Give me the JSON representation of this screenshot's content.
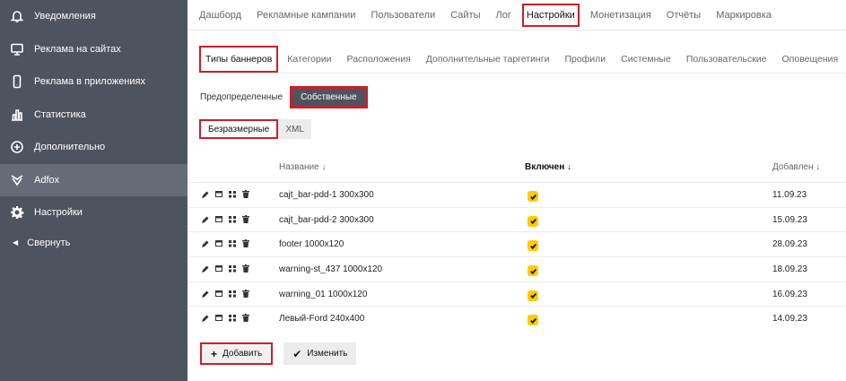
{
  "sidebar": {
    "items": [
      {
        "label": "Уведомления",
        "icon": "bell-icon",
        "active": false
      },
      {
        "label": "Реклама на сайтах",
        "icon": "monitor-icon",
        "active": false
      },
      {
        "label": "Реклама в приложениях",
        "icon": "phone-icon",
        "active": false
      },
      {
        "label": "Статистика",
        "icon": "bar-chart-icon",
        "active": false
      },
      {
        "label": "Дополнительно",
        "icon": "plus-circle-icon",
        "active": false
      },
      {
        "label": "Adfox",
        "icon": "adfox-icon",
        "active": true
      },
      {
        "label": "Настройки",
        "icon": "gear-icon",
        "active": false
      }
    ],
    "collapse_label": "Свернуть"
  },
  "topnav": {
    "tabs": [
      "Дашборд",
      "Рекламные кампании",
      "Пользователи",
      "Сайты",
      "Лог",
      "Настройки",
      "Монетизация",
      "Отчёты",
      "Маркировка"
    ],
    "active_index": 5
  },
  "subtabs": {
    "tabs": [
      "Типы баннеров",
      "Категории",
      "Расположения",
      "Дополнительные таргетинги",
      "Профили",
      "Системные",
      "Пользовательские",
      "Оповещения"
    ],
    "active_index": 0
  },
  "segment_source": {
    "options": [
      "Предопределенные",
      "Собственные"
    ],
    "active_index": 1
  },
  "segment_type": {
    "options": [
      "Безразмерные",
      "XML"
    ],
    "active_index": 0
  },
  "table": {
    "columns": {
      "name": "Название ↓",
      "enabled": "Включен ↓",
      "added": "Добавлен ↓"
    },
    "rows": [
      {
        "name": "cajt_bar-pdd-1 300x300",
        "enabled": true,
        "added": "11.09.23"
      },
      {
        "name": "cajt_bar-pdd-2 300x300",
        "enabled": true,
        "added": "15.09.23"
      },
      {
        "name": "footer 1000x120",
        "enabled": true,
        "added": "28.09.23"
      },
      {
        "name": "warning-st_437 1000x120",
        "enabled": true,
        "added": "18.09.23"
      },
      {
        "name": "warning_01 1000x120",
        "enabled": true,
        "added": "16.09.23"
      },
      {
        "name": "Левый-Ford 240x400",
        "enabled": true,
        "added": "14.09.23"
      }
    ]
  },
  "buttons": {
    "add_label": "Добавить",
    "add_glyph": "+",
    "edit_label": "Изменить",
    "edit_glyph": "✔"
  },
  "colors": {
    "sidebar_bg": "#4e5360",
    "sidebar_active": "#656b77",
    "highlight": "#c8202a",
    "checkbox": "#ffcc00"
  }
}
